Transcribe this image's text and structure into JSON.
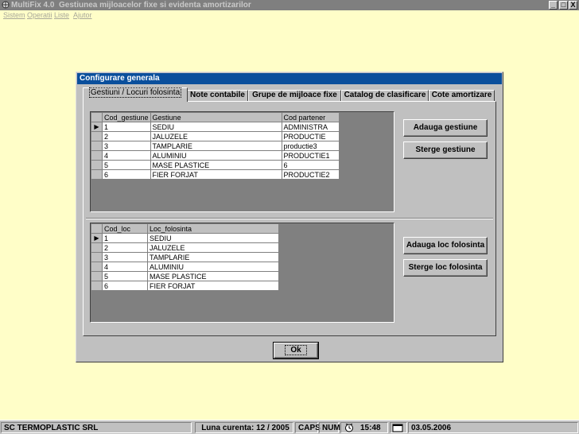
{
  "window": {
    "app_name": "MultiFix 4.0",
    "title": "Gestiunea mijloacelor fixe si evidenta amortizarilor",
    "controls": [
      "_",
      "□",
      "X"
    ]
  },
  "menu": {
    "items": [
      {
        "label": "Sistem"
      },
      {
        "label": "Operatii"
      },
      {
        "label": "Liste"
      },
      {
        "label": "Ajutor"
      }
    ]
  },
  "dialog": {
    "title": "Configurare generala",
    "tabs": [
      {
        "label": "Gestiuni / Locuri folosinta",
        "active": true
      },
      {
        "label": "Note contabile"
      },
      {
        "label": "Grupe de mijloace fixe"
      },
      {
        "label": "Catalog de clasificare"
      },
      {
        "label": "Cote amortizare"
      }
    ],
    "gestiuni_grid": {
      "columns": [
        "Cod_gestiune",
        "Gestiune",
        "Cod partener"
      ],
      "selected_marker": "▶",
      "rows": [
        [
          "1",
          "SEDIU",
          "ADMINISTRA"
        ],
        [
          "2",
          "JALUZELE",
          "PRODUCTIE"
        ],
        [
          "3",
          "TAMPLARIE",
          "productie3"
        ],
        [
          "4",
          "ALUMINIU",
          "PRODUCTIE1"
        ],
        [
          "5",
          "MASE PLASTICE",
          "6"
        ],
        [
          "6",
          "FIER FORJAT",
          "PRODUCTIE2"
        ]
      ]
    },
    "locuri_grid": {
      "columns": [
        "Cod_loc",
        "Loc_folosinta"
      ],
      "rows": [
        [
          "1",
          "SEDIU"
        ],
        [
          "2",
          "JALUZELE"
        ],
        [
          "3",
          "TAMPLARIE"
        ],
        [
          "4",
          "ALUMINIU"
        ],
        [
          "5",
          "MASE PLASTICE"
        ],
        [
          "6",
          "FIER FORJAT"
        ]
      ]
    },
    "buttons": {
      "add_gestiune": "Adauga gestiune",
      "del_gestiune": "Sterge gestiune",
      "add_loc": "Adauga loc folosinta",
      "del_loc": "Sterge loc folosinta",
      "ok": "Ok"
    }
  },
  "status": {
    "company": "SC TERMOPLASTIC SRL",
    "luna": "Luna curenta: 12 / 2005",
    "caps": "CAPS",
    "num": "NUM",
    "time": "15:48",
    "date": "03.05.2006"
  },
  "colors": {
    "desktop": "#fffec8",
    "dialog_title": "#0a4f9c",
    "window_title": "#7f7f7f"
  }
}
